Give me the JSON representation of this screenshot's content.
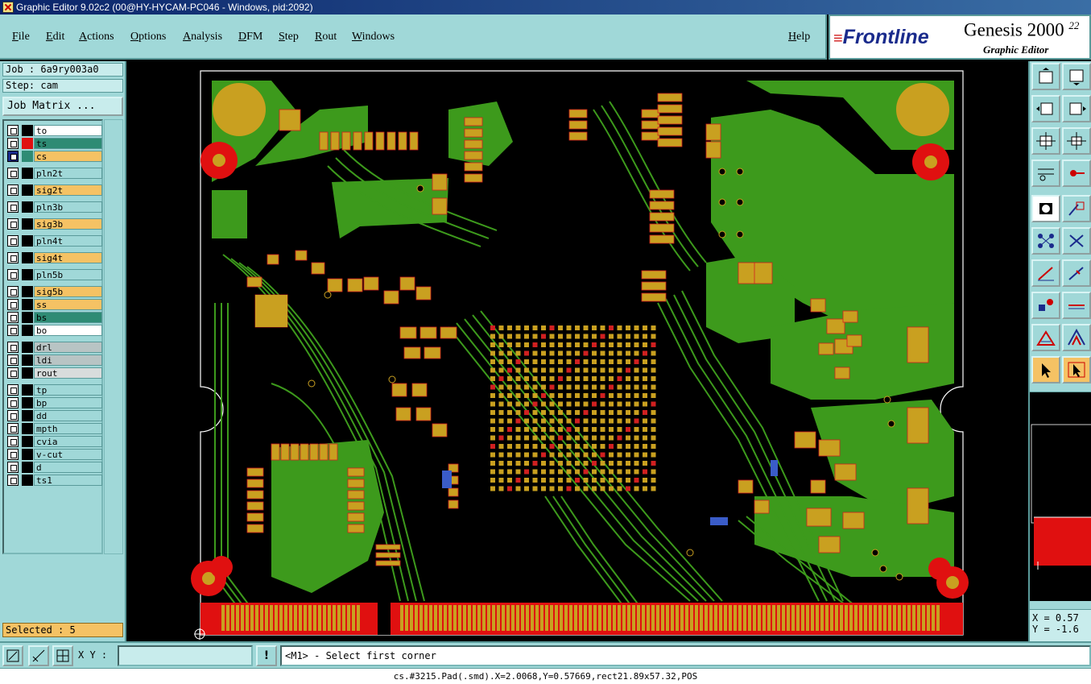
{
  "window": {
    "title": "Graphic Editor 9.02c2 (00@HY-HYCAM-PC046 - Windows, pid:2092)"
  },
  "menu": {
    "file": "File",
    "edit": "Edit",
    "actions": "Actions",
    "options": "Options",
    "analysis": "Analysis",
    "dfm": "DFM",
    "step": "Step",
    "rout": "Rout",
    "windows": "Windows",
    "help": "Help"
  },
  "brand": {
    "frontline": "Frontline",
    "product": "Genesis 2000",
    "version_sup": "22",
    "subtitle": "Graphic Editor"
  },
  "job": {
    "job_label": "Job : 6a9ry003a0",
    "step_label": "Step: cam",
    "matrix_button": "Job Matrix ..."
  },
  "layers": [
    {
      "name": "to",
      "color": "#ffffff",
      "indicator": "#000000"
    },
    {
      "name": "ts",
      "color": "#2e8b74",
      "indicator": "#e01010"
    },
    {
      "name": "cs",
      "color": "#f5c264",
      "indicator": "#2e8b74",
      "active": true
    },
    {
      "name": "pln2t",
      "color": "#a0d8d8",
      "indicator": "#000000"
    },
    {
      "name": "sig2t",
      "color": "#f5c264",
      "indicator": "#000000"
    },
    {
      "name": "pln3b",
      "color": "#a0d8d8",
      "indicator": "#000000"
    },
    {
      "name": "sig3b",
      "color": "#f5c264",
      "indicator": "#000000"
    },
    {
      "name": "pln4t",
      "color": "#a0d8d8",
      "indicator": "#000000"
    },
    {
      "name": "sig4t",
      "color": "#f5c264",
      "indicator": "#000000"
    },
    {
      "name": "pln5b",
      "color": "#a0d8d8",
      "indicator": "#000000"
    },
    {
      "name": "sig5b",
      "color": "#f5c264",
      "indicator": "#000000"
    },
    {
      "name": "ss",
      "color": "#f5c264",
      "indicator": "#000000"
    },
    {
      "name": "bs",
      "color": "#2e8b74",
      "indicator": "#000000"
    },
    {
      "name": "bo",
      "color": "#ffffff",
      "indicator": "#000000"
    },
    {
      "name": "drl",
      "color": "#b8c4c4",
      "indicator": "#000000"
    },
    {
      "name": "ldi",
      "color": "#b8c4c4",
      "indicator": "#000000"
    },
    {
      "name": "rout",
      "color": "#d8dcdc",
      "indicator": "#000000"
    },
    {
      "name": "tp",
      "color": "#a0d8d8",
      "indicator": "#000000"
    },
    {
      "name": "bp",
      "color": "#a0d8d8",
      "indicator": "#000000"
    },
    {
      "name": "dd",
      "color": "#a0d8d8",
      "indicator": "#000000"
    },
    {
      "name": "mpth",
      "color": "#a0d8d8",
      "indicator": "#000000"
    },
    {
      "name": "cvia",
      "color": "#a0d8d8",
      "indicator": "#000000"
    },
    {
      "name": "v-cut",
      "color": "#a0d8d8",
      "indicator": "#000000"
    },
    {
      "name": "d",
      "color": "#a0d8d8",
      "indicator": "#000000"
    },
    {
      "name": "ts1",
      "color": "#a0d8d8",
      "indicator": "#000000"
    }
  ],
  "selection": {
    "label": "Selected : 5"
  },
  "coords": {
    "x_label": "X = 0.57",
    "y_label": "Y = -1.6"
  },
  "bottom": {
    "xy_label": "X Y :",
    "xy_value": "",
    "prompt": "<M1> - Select first corner",
    "status": "cs.#3215.Pad(.smd).X=2.0068,Y=0.57669,rect21.89x57.32,POS"
  },
  "colors": {
    "copper": "#3d9a1c",
    "pad": "#c9a020",
    "pad_edge": "#d02020",
    "teal": "#a0d8d8"
  }
}
